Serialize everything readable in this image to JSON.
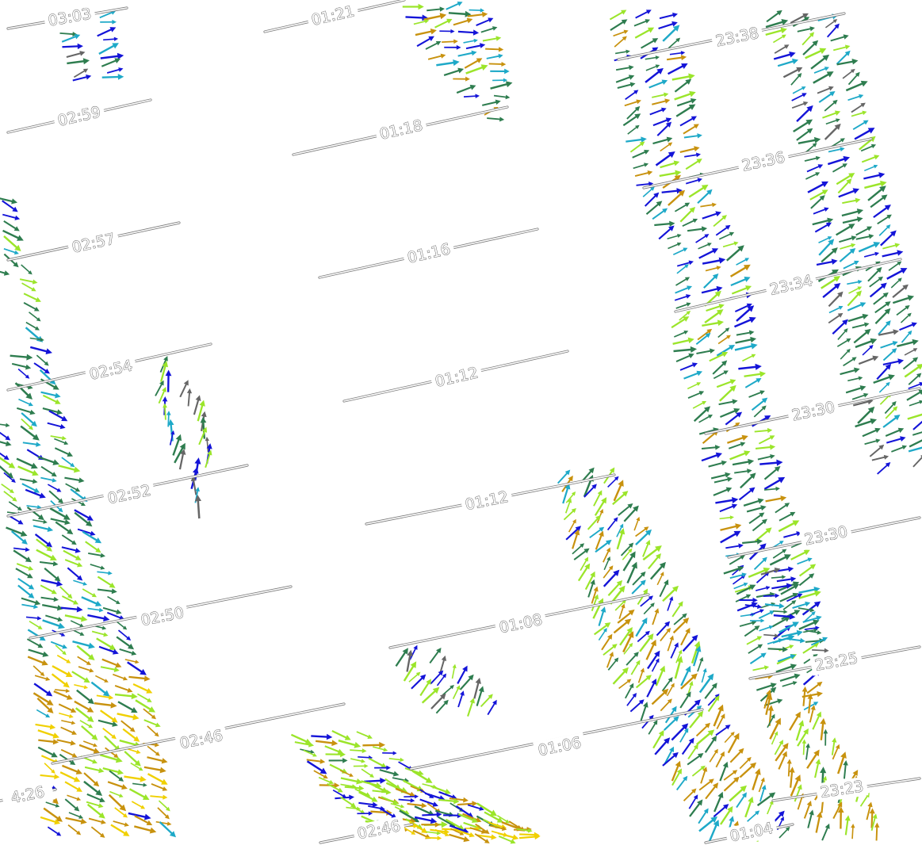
{
  "tracks": [
    {
      "label": "03:03"
    },
    {
      "label": "02:59"
    },
    {
      "label": "02:57"
    },
    {
      "label": "02:54"
    },
    {
      "label": "02:52"
    },
    {
      "label": "02:50"
    },
    {
      "label": "02:46"
    },
    {
      "label": "02:46"
    },
    {
      "label": "01:21"
    },
    {
      "label": "01:18"
    },
    {
      "label": "01:16"
    },
    {
      "label": "01:12"
    },
    {
      "label": "01:12"
    },
    {
      "label": "01:08"
    },
    {
      "label": "01:06"
    },
    {
      "label": "01:04"
    },
    {
      "label": "23:38"
    },
    {
      "label": "23:36"
    },
    {
      "label": "23:34"
    },
    {
      "label": "23:30"
    },
    {
      "label": "23:30"
    },
    {
      "label": "23:25"
    },
    {
      "label": "23:23"
    },
    {
      "label": "4:26"
    }
  ],
  "colors": {
    "dark_green": "#2e7d4f",
    "light_green": "#9be52a",
    "dark_blue": "#1414d8",
    "cyan": "#1ea9c8",
    "gold": "#c8920e",
    "yellow": "#f0d000",
    "gray": "#666666",
    "track": "#7a7a7a"
  }
}
